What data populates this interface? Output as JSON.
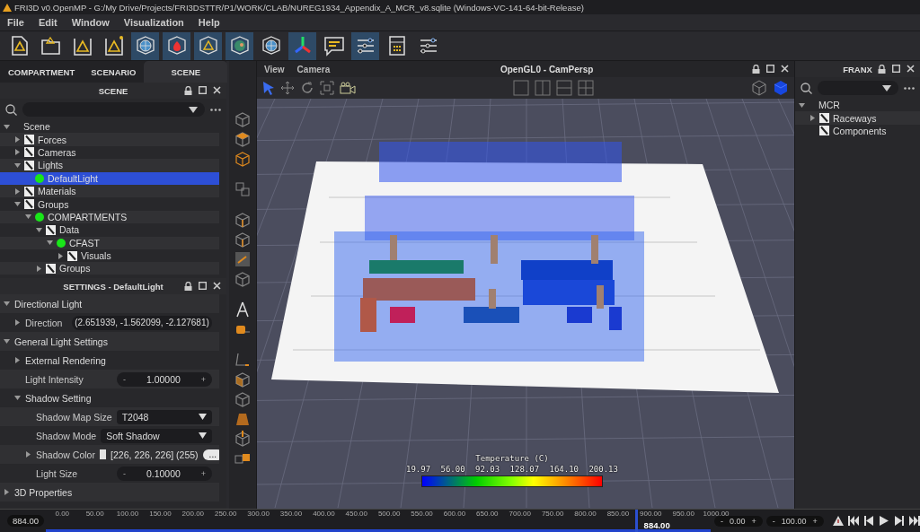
{
  "window": {
    "title": "FRI3D v0.OpenMP - G:/My Drive/Projects/FRI3DSTTR/P1/WORK/CLAB/NUREG1934_Appendix_A_MCR_v8.sqlite (Windows-VC-141-64-bit-Release)"
  },
  "menu": [
    "File",
    "Edit",
    "Window",
    "Visualization",
    "Help"
  ],
  "toolbar": [
    {
      "kind": "doc",
      "on": false
    },
    {
      "kind": "folder",
      "on": false
    },
    {
      "kind": "triangle",
      "on": false
    },
    {
      "kind": "triangle-star",
      "on": false
    },
    {
      "kind": "globe-cube",
      "on": true
    },
    {
      "kind": "fire-cube",
      "on": true
    },
    {
      "kind": "triangle-cube",
      "on": true
    },
    {
      "kind": "earth-cube",
      "on": true
    },
    {
      "kind": "globe-cube",
      "on": false
    },
    {
      "kind": "axes",
      "on": true
    },
    {
      "kind": "message",
      "on": false
    },
    {
      "kind": "sliders",
      "on": true
    },
    {
      "kind": "calculator",
      "on": false
    },
    {
      "kind": "sliders",
      "on": false
    }
  ],
  "left_tabs": [
    {
      "label": "COMPARTMENT",
      "selected": false
    },
    {
      "label": "SCENARIO",
      "selected": false
    },
    {
      "label": "SCENE",
      "selected": true
    }
  ],
  "scene_panel": {
    "title": "SCENE",
    "tree": [
      {
        "label": "Scene",
        "expanded": true,
        "selected": false,
        "children": [
          {
            "label": "Forces",
            "kind": "folder",
            "expanded": false,
            "selected": false
          },
          {
            "label": "Cameras",
            "kind": "folder",
            "expanded": false,
            "selected": false
          },
          {
            "label": "Lights",
            "kind": "folder",
            "expanded": true,
            "selected": false,
            "children": [
              {
                "label": "DefaultLight",
                "kind": "dot",
                "selected": true
              }
            ]
          },
          {
            "label": "Materials",
            "kind": "folder",
            "expanded": false,
            "selected": false
          },
          {
            "label": "Groups",
            "kind": "folder",
            "expanded": true,
            "selected": false,
            "children": [
              {
                "label": "COMPARTMENTS",
                "kind": "dot",
                "expanded": true,
                "selected": false,
                "children": [
                  {
                    "label": "Data",
                    "kind": "folder",
                    "expanded": true,
                    "selected": false,
                    "children": [
                      {
                        "label": "CFAST",
                        "kind": "dot",
                        "expanded": true,
                        "selected": false,
                        "children": [
                          {
                            "label": "Visuals",
                            "kind": "folder",
                            "expanded": false,
                            "selected": false
                          }
                        ]
                      }
                    ]
                  },
                  {
                    "label": "Groups",
                    "kind": "folder",
                    "expanded": false,
                    "selected": false
                  }
                ]
              }
            ]
          }
        ]
      }
    ]
  },
  "settings_panel": {
    "title": "SETTINGS - DefaultLight",
    "rows": [
      {
        "kind": "section",
        "label": "Directional Light",
        "expanded": true,
        "children": [
          {
            "kind": "vector",
            "label": "Direction",
            "expanded": false,
            "value": "(2.651939, -1.562099, -2.127681)"
          }
        ]
      },
      {
        "kind": "section",
        "label": "General Light Settings",
        "expanded": true,
        "children": [
          {
            "kind": "section",
            "label": "External Rendering",
            "expanded": false
          },
          {
            "kind": "spinner",
            "label": "Light Intensity",
            "minus": "-",
            "value": "1.00000",
            "plus": "+"
          },
          {
            "kind": "section",
            "label": "Shadow Setting",
            "expanded": true,
            "children": [
              {
                "kind": "dropdown",
                "label": "Shadow Map Size",
                "value": "T2048"
              },
              {
                "kind": "dropdown",
                "label": "Shadow Mode",
                "value": "Soft Shadow"
              },
              {
                "kind": "color",
                "label": "Shadow Color",
                "expanded": false,
                "value": "[226, 226, 226] (255)",
                "button": "..."
              },
              {
                "kind": "spinner",
                "label": "Light Size",
                "minus": "-",
                "value": "0.10000",
                "plus": "+"
              }
            ]
          }
        ]
      },
      {
        "kind": "section",
        "label": "3D Properties",
        "expanded": false
      }
    ]
  },
  "viewport": {
    "menu": [
      "View",
      "Camera"
    ],
    "title": "OpenGL0 - CamPersp",
    "legend": {
      "title": "Temperature (C)",
      "ticks": [
        "19.97",
        "56.00",
        "92.03",
        "128.07",
        "164.10",
        "200.13"
      ]
    }
  },
  "right_panel": {
    "title": "FRANX",
    "tree": [
      {
        "label": "MCR",
        "expanded": true,
        "selected": false,
        "children": [
          {
            "label": "Raceways",
            "kind": "folder",
            "expanded": false,
            "selected": false
          },
          {
            "label": "Components",
            "kind": "folder",
            "selected": false
          }
        ]
      }
    ]
  },
  "timeline": {
    "current": "884.00",
    "ticks": [
      "0.00",
      "50.00",
      "100.00",
      "150.00",
      "200.00",
      "250.00",
      "300.00",
      "350.00",
      "400.00",
      "450.00",
      "500.00",
      "550.00",
      "600.00",
      "650.00",
      "700.00",
      "750.00",
      "800.00",
      "850.00",
      "900.00",
      "950.00",
      "1000.00"
    ],
    "level": 0.884,
    "marker_label": "884.00",
    "start": {
      "minus": "-",
      "value": "0.00",
      "plus": "+"
    },
    "end": {
      "minus": "-",
      "value": "100.00",
      "plus": "+"
    }
  }
}
